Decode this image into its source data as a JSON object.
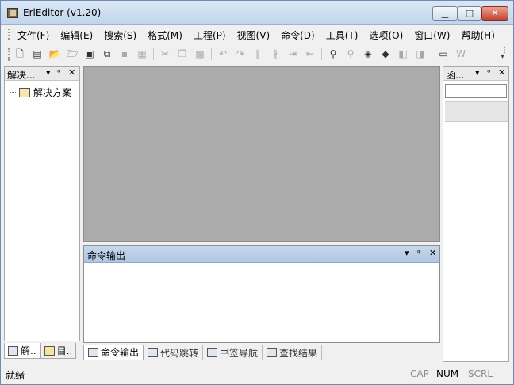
{
  "window": {
    "title": "ErlEditor (v1.20)"
  },
  "menu": [
    "文件(F)",
    "编辑(E)",
    "搜索(S)",
    "格式(M)",
    "工程(P)",
    "视图(V)",
    "命令(D)",
    "工具(T)",
    "选项(O)",
    "窗口(W)",
    "帮助(H)"
  ],
  "left_panel": {
    "title": "解决...",
    "tree_item": "解决方案",
    "tabs": [
      "解..",
      "目.."
    ]
  },
  "output_panel": {
    "title": "命令输出"
  },
  "bottom_tabs": [
    "命令输出",
    "代码跳转",
    "书签导航",
    "查找结果"
  ],
  "right_panel": {
    "title": "函..."
  },
  "status": {
    "message": "就绪",
    "indicators": [
      {
        "label": "CAP",
        "on": false
      },
      {
        "label": "NUM",
        "on": true
      },
      {
        "label": "SCRL",
        "on": false
      }
    ]
  },
  "icons": {
    "window_controls": [
      "minimize-icon",
      "maximize-icon",
      "close-icon"
    ],
    "toolbar": [
      "new-file-icon",
      "new-project-icon",
      "open-icon",
      "open-project-icon",
      "save-settings-icon",
      "project-icon",
      "save-icon",
      "save-all-icon",
      "cut-icon",
      "copy-icon",
      "paste-icon",
      "undo-icon",
      "redo-icon",
      "comment-icon",
      "uncomment-icon",
      "indent-icon",
      "outdent-icon",
      "find-icon",
      "find-next-icon",
      "find-in-files-icon",
      "replace-icon",
      "back-icon",
      "forward-icon",
      "window-icon",
      "word-wrap-icon"
    ]
  }
}
